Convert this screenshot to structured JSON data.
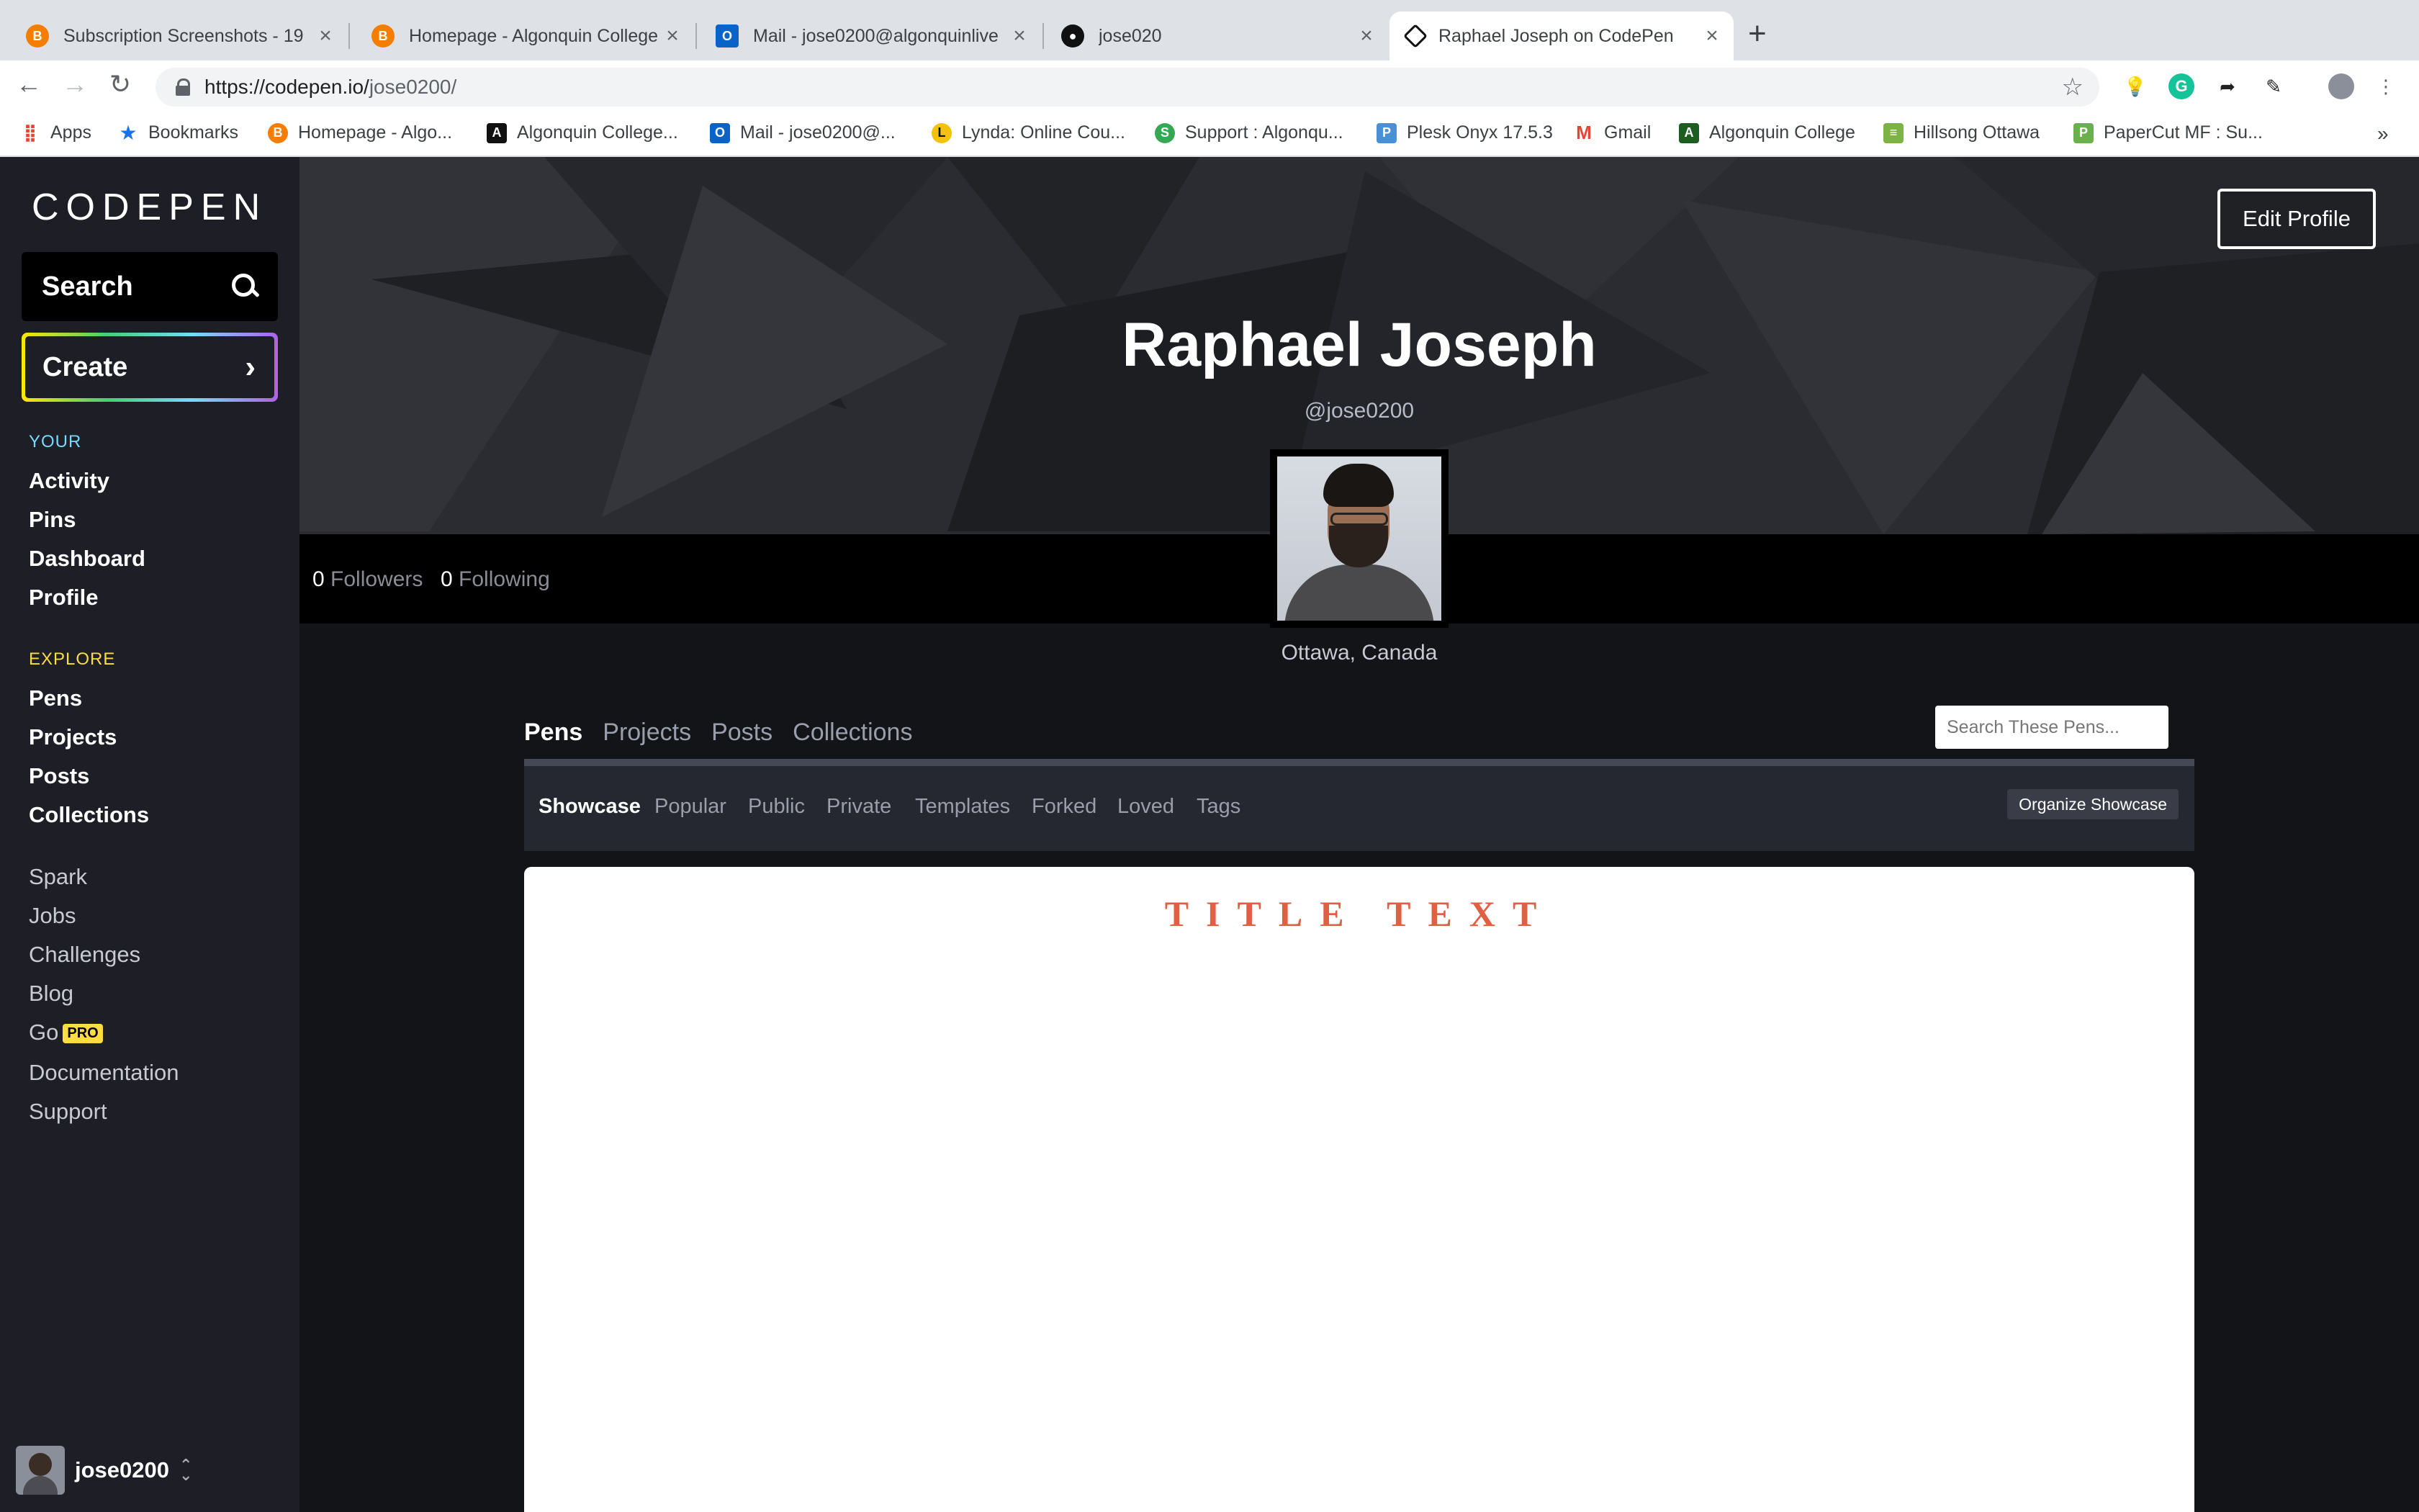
{
  "browser": {
    "tabs": [
      {
        "title": "Subscription Screenshots - 19",
        "icon": "blogger-icon",
        "color": "#f57d00"
      },
      {
        "title": "Homepage - Algonquin College",
        "icon": "blogger-icon",
        "color": "#f57d00"
      },
      {
        "title": "Mail - jose0200@algonquinlive",
        "icon": "outlook-icon",
        "color": "#0a64c8"
      },
      {
        "title": "jose020",
        "icon": "github-icon",
        "color": "#111111"
      },
      {
        "title": "Raphael Joseph on CodePen",
        "icon": "codepen-icon",
        "color": "#111111",
        "active": true
      }
    ],
    "url_host": "https://codepen.io/",
    "url_path": "jose0200/",
    "bookmarks": [
      {
        "label": "Apps",
        "icon": "apps-grid-icon"
      },
      {
        "label": "Bookmarks",
        "icon": "star-icon"
      },
      {
        "label": "Homepage - Algo...",
        "icon": "blogger-icon"
      },
      {
        "label": "Algonquin College...",
        "icon": "algonquin-icon"
      },
      {
        "label": "Mail - jose0200@...",
        "icon": "outlook-icon"
      },
      {
        "label": "Lynda: Online Cou...",
        "icon": "lynda-icon"
      },
      {
        "label": "Support : Algonqu...",
        "icon": "support-icon"
      },
      {
        "label": "Plesk Onyx 17.5.3",
        "icon": "plesk-icon"
      },
      {
        "label": "Gmail",
        "icon": "gmail-icon"
      },
      {
        "label": "Algonquin College",
        "icon": "ac-icon"
      },
      {
        "label": "Hillsong Ottawa",
        "icon": "hillsong-icon"
      },
      {
        "label": "PaperCut MF : Su...",
        "icon": "papercut-icon"
      }
    ],
    "more": "»"
  },
  "sidebar": {
    "logo": "CODEPEN",
    "search_label": "Search",
    "create_label": "Create",
    "your_heading": "YOUR",
    "your_color": "#76daff",
    "your_items": [
      "Activity",
      "Pins",
      "Dashboard",
      "Profile"
    ],
    "explore_heading": "EXPLORE",
    "explore_color": "#ffdd40",
    "explore_items": [
      "Pens",
      "Projects",
      "Posts",
      "Collections"
    ],
    "misc_items": [
      "Spark",
      "Jobs",
      "Challenges",
      "Blog",
      "Go",
      "Documentation",
      "Support"
    ],
    "pro_badge": "PRO",
    "username": "jose0200"
  },
  "profile": {
    "edit_label": "Edit Profile",
    "name": "Raphael Joseph",
    "handle": "@jose0200",
    "followers_count": "0",
    "followers_label": "Followers",
    "following_count": "0",
    "following_label": "Following",
    "location": "Ottawa, Canada"
  },
  "content": {
    "tabs": [
      "Pens",
      "Projects",
      "Posts",
      "Collections"
    ],
    "active_tab": "Pens",
    "search_placeholder": "Search These Pens...",
    "subtabs": [
      "Showcase",
      "Popular",
      "Public",
      "Private",
      "Templates",
      "Forked",
      "Loved",
      "Tags"
    ],
    "active_subtab": "Showcase",
    "organize_label": "Organize Showcase",
    "showcase_title": "TITLE TEXT",
    "showcase_title_color": "#e06043"
  }
}
